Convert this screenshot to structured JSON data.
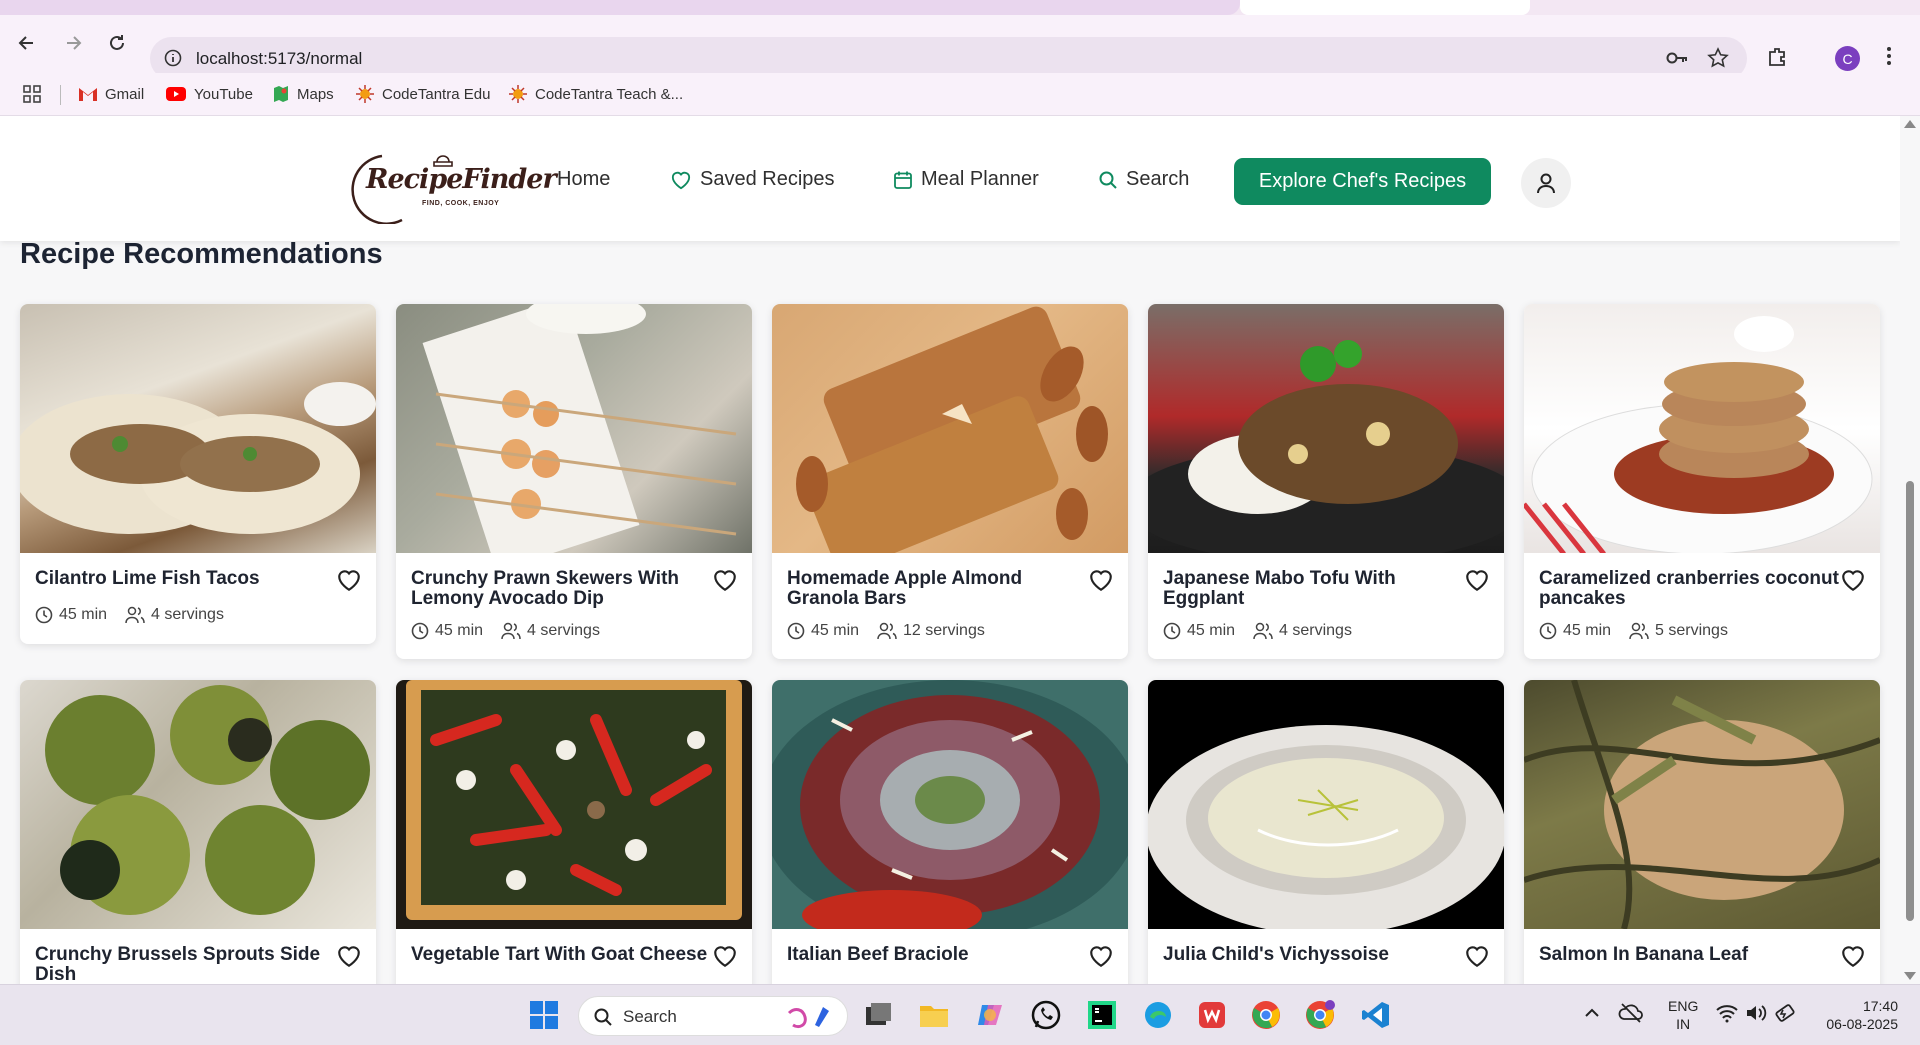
{
  "browser": {
    "url": "localhost:5173/normal",
    "profile_initial": "C",
    "bookmarks": [
      "Gmail",
      "YouTube",
      "Maps",
      "CodeTantra Edu",
      "CodeTantra Teach &..."
    ]
  },
  "header": {
    "logo_name": "RecipeFinder",
    "logo_tagline": "FIND, COOK, ENJOY",
    "nav": {
      "home": "Home",
      "saved": "Saved Recipes",
      "planner": "Meal Planner",
      "search": "Search"
    },
    "cta": "Explore Chef's Recipes"
  },
  "section_title": "Recipe Recommendations",
  "recipes": [
    {
      "title": "Cilantro Lime Fish Tacos",
      "time": "45 min",
      "servings": "4 servings"
    },
    {
      "title": "Crunchy Prawn Skewers With Lemony Avocado Dip",
      "time": "45 min",
      "servings": "4 servings"
    },
    {
      "title": "Homemade Apple Almond Granola Bars",
      "time": "45 min",
      "servings": "12 servings"
    },
    {
      "title": "Japanese Mabo Tofu With Eggplant",
      "time": "45 min",
      "servings": "4 servings"
    },
    {
      "title": "Caramelized cranberries coconut pancakes",
      "time": "45 min",
      "servings": "5 servings"
    },
    {
      "title": "Crunchy Brussels Sprouts Side Dish"
    },
    {
      "title": "Vegetable Tart With Goat Cheese"
    },
    {
      "title": "Italian Beef Braciole"
    },
    {
      "title": "Julia Child's Vichyssoise"
    },
    {
      "title": "Salmon In Banana Leaf"
    }
  ],
  "taskbar": {
    "search_label": "Search",
    "lang_top": "ENG",
    "lang_bottom": "IN",
    "time": "17:40",
    "date": "06-08-2025"
  }
}
